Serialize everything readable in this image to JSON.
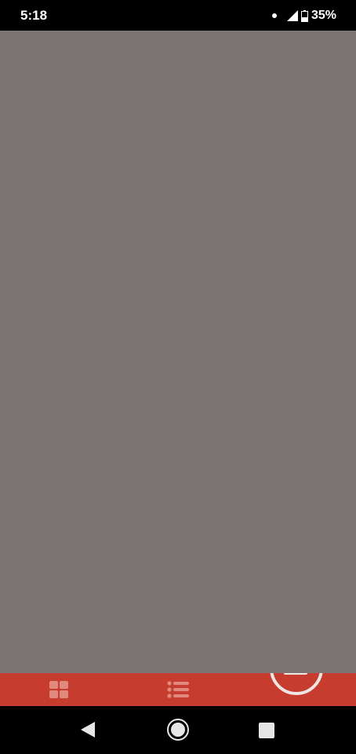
{
  "status_bar": {
    "time": "5:18",
    "battery_percent": "35%",
    "battery_level": 0.35,
    "icons": [
      "notification-dot-icon",
      "signal-icon",
      "battery-icon"
    ]
  },
  "overlay": {
    "color": "#7d7574"
  },
  "bottom_bar": {
    "color": "#c63c2f",
    "icons": [
      "dashboard-grid-icon",
      "list-icon",
      "fab-button-icon"
    ]
  },
  "nav_bar": {
    "icons": [
      "back-icon",
      "home-icon",
      "recents-icon"
    ]
  }
}
